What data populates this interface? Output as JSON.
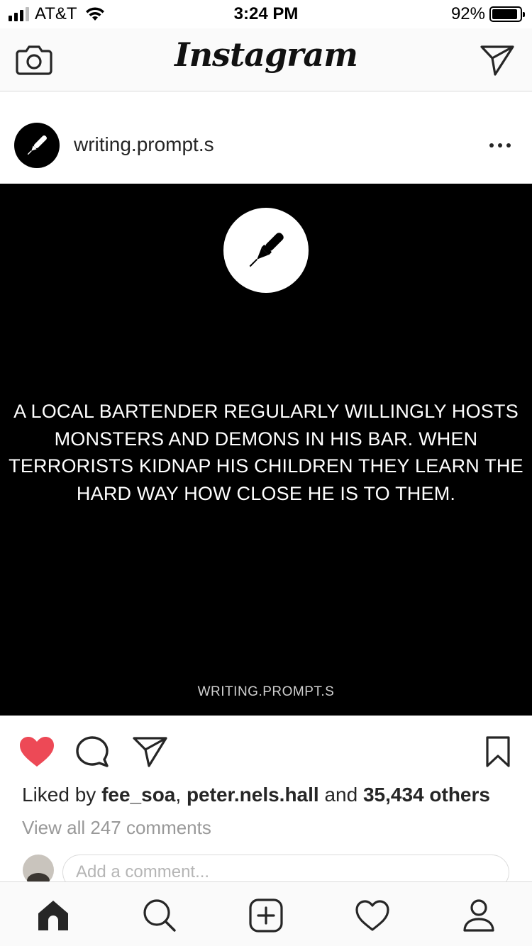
{
  "status_bar": {
    "carrier": "AT&T",
    "time": "3:24 PM",
    "battery_percent": "92%",
    "battery_level": 0.92,
    "signal_bars": 3
  },
  "header": {
    "logo": "Instagram",
    "camera_icon": "camera-icon",
    "direct_icon": "paper-plane-icon"
  },
  "post": {
    "username": "writing.prompt.s",
    "avatar_icon": "pen-icon",
    "more_icon": "more-dots-icon",
    "image": {
      "prompt": "A LOCAL BARTENDER REGULARLY WILLINGLY HOSTS MONSTERS AND DEMONS IN HIS BAR. WHEN TERRORISTS KIDNAP HIS CHILDREN THEY LEARN THE HARD WAY HOW CLOSE HE IS TO THEM.",
      "watermark": "WRITING.PROMPT.S"
    },
    "liked": true,
    "like_color": "#ed4956",
    "likes": {
      "prefix": "Liked by ",
      "user1": "fee_soa",
      "separator": ", ",
      "user2": "peter.nels.hall",
      "conjunction": " and ",
      "others": "35,434 others"
    },
    "view_comments": "View all 247 comments",
    "comment_placeholder": "Add a comment..."
  },
  "tab_bar": {
    "items": [
      "home-icon",
      "search-icon",
      "add-post-icon",
      "activity-heart-icon",
      "profile-icon"
    ],
    "active": "home-icon"
  }
}
